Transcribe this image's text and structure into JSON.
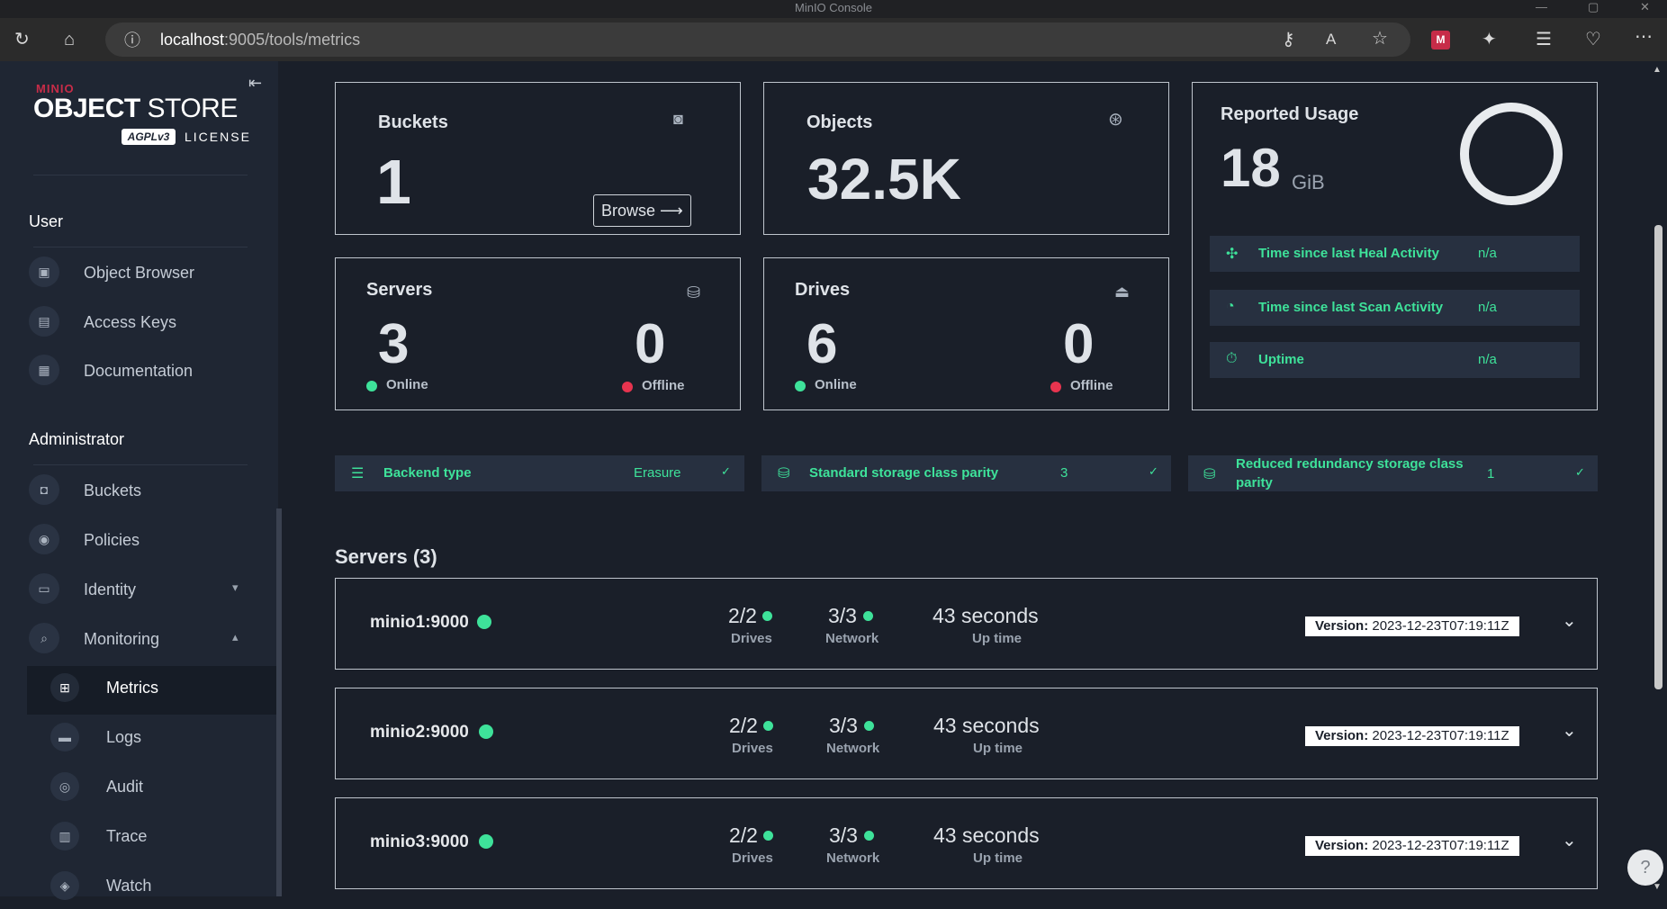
{
  "window": {
    "title": "MinIO Console"
  },
  "browser": {
    "url_host": "localhost",
    "url_path": ":9005/tools/metrics"
  },
  "sidebar": {
    "logo_brand": "MINIO",
    "logo_object": "OBJECT",
    "logo_store": " STORE",
    "logo_agpl": "AGPLv3",
    "logo_license": "LICENSE",
    "user_section": "User",
    "user_items": [
      {
        "label": "Object Browser"
      },
      {
        "label": "Access Keys"
      },
      {
        "label": "Documentation"
      }
    ],
    "admin_section": "Administrator",
    "admin_items": [
      {
        "label": "Buckets"
      },
      {
        "label": "Policies"
      },
      {
        "label": "Identity"
      },
      {
        "label": "Monitoring"
      }
    ],
    "monitoring_items": [
      {
        "label": "Metrics"
      },
      {
        "label": "Logs"
      },
      {
        "label": "Audit"
      },
      {
        "label": "Trace"
      },
      {
        "label": "Watch"
      }
    ]
  },
  "cards": {
    "buckets": {
      "title": "Buckets",
      "value": "1",
      "browse_label": "Browse"
    },
    "objects": {
      "title": "Objects",
      "value": "32.5K"
    },
    "usage": {
      "title": "Reported Usage",
      "value": "18",
      "unit": "GiB"
    },
    "servers": {
      "title": "Servers",
      "online_value": "3",
      "online_label": "Online",
      "offline_value": "0",
      "offline_label": "Offline"
    },
    "drives": {
      "title": "Drives",
      "online_value": "6",
      "online_label": "Online",
      "offline_value": "0",
      "offline_label": "Offline"
    }
  },
  "activity": [
    {
      "label": "Time since last Heal Activity",
      "value": "n/a"
    },
    {
      "label": "Time since last Scan Activity",
      "value": "n/a"
    },
    {
      "label": "Uptime",
      "value": "n/a"
    }
  ],
  "status_strips": [
    {
      "label": "Backend type",
      "value": "Erasure"
    },
    {
      "label": "Standard storage class parity",
      "value": "3"
    },
    {
      "label_line1": "Reduced redundancy storage class",
      "label_line2": "parity",
      "value": "1"
    }
  ],
  "servers_section": {
    "title": "Servers (3)"
  },
  "servers": [
    {
      "name": "minio1:9000",
      "drives": "2/2",
      "drives_label": "Drives",
      "network": "3/3",
      "network_label": "Network",
      "uptime": "43 seconds",
      "uptime_label": "Up time",
      "version_label": "Version:",
      "version": "2023-12-23T07:19:11Z"
    },
    {
      "name": "minio2:9000",
      "drives": "2/2",
      "drives_label": "Drives",
      "network": "3/3",
      "network_label": "Network",
      "uptime": "43 seconds",
      "uptime_label": "Up time",
      "version_label": "Version:",
      "version": "2023-12-23T07:19:11Z"
    },
    {
      "name": "minio3:9000",
      "drives": "2/2",
      "drives_label": "Drives",
      "network": "3/3",
      "network_label": "Network",
      "uptime": "43 seconds",
      "uptime_label": "Up time",
      "version_label": "Version:",
      "version": "2023-12-23T07:19:11Z"
    }
  ],
  "colors": {
    "accent_green": "#3ee29a",
    "offline_red": "#e7344f",
    "brand_red": "#c72c48"
  }
}
